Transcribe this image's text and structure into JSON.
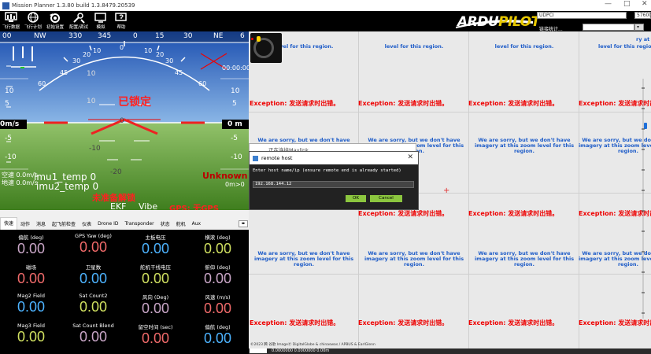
{
  "window": {
    "title": "Mission Planner 1.3.80 build 1.3.8479.20539",
    "controls": [
      "—",
      "□",
      "✕"
    ]
  },
  "toolbar": {
    "buttons": [
      {
        "label": "飞行数据",
        "icon": "flight-data-icon"
      },
      {
        "label": "飞行计划",
        "icon": "flight-plan-icon"
      },
      {
        "label": "初始设置",
        "icon": "initial-setup-icon"
      },
      {
        "label": "配置/调试",
        "icon": "config-tuning-icon"
      },
      {
        "label": "模拟",
        "icon": "simulation-icon"
      },
      {
        "label": "帮助",
        "icon": "help-icon"
      }
    ],
    "logo_a": "ARDU",
    "logo_b": "PILOT",
    "port": "UDPCI",
    "baud": "57600",
    "link_stats": "链接统计..."
  },
  "hud": {
    "heading_labels": [
      "00",
      "NW",
      "330",
      "345",
      "0",
      "15",
      "30",
      "NE",
      "6"
    ],
    "pitch_left": [
      "10",
      "5",
      "0m/s",
      "-5",
      "-10"
    ],
    "pitch_right": [
      "10",
      "5",
      "0 m",
      "-5",
      "-10"
    ],
    "pitch_center": [
      "10",
      "0",
      "-10",
      "-20"
    ],
    "roll_labels": [
      "10",
      "20",
      "30",
      "45",
      "60"
    ],
    "lock_status": "已锁定",
    "time": "00:00:00",
    "airspeed_line": "空速 0.0m/s",
    "groundspeed_line": "地速 0.0m/s",
    "imu1": "imu1_temp 0",
    "imu2": "imu2_temp 0",
    "mode": "Unknown",
    "dist": "0m>0",
    "not_ready": "未准备解锁",
    "ekf": "EKF",
    "vibe": "Vibe",
    "gps": "GPS: 无GPS"
  },
  "tabs": {
    "items": [
      "快速",
      "动作",
      "消息",
      "起飞前检查",
      "仪表",
      "Drone ID",
      "Transponder",
      "状态",
      "舵机",
      "Aux"
    ],
    "active": 0
  },
  "quick": {
    "cells": [
      {
        "label": "偏航 (deg)",
        "value": "0.00",
        "color": "#c9a6c7"
      },
      {
        "label": "GPS Yaw (deg)",
        "value": "0.00",
        "color": "#f06a6a"
      },
      {
        "label": "主板电压",
        "value": "0.00",
        "color": "#4db3ff"
      },
      {
        "label": "横滚 (deg)",
        "value": "0.00",
        "color": "#d0e060"
      },
      {
        "label": "磁场",
        "value": "0.00",
        "color": "#f06a6a"
      },
      {
        "label": "卫星数",
        "value": "0.00",
        "color": "#4db3ff"
      },
      {
        "label": "舵机干线电压",
        "value": "0.00",
        "color": "#d0e060"
      },
      {
        "label": "俯仰 (deg)",
        "value": "0.00",
        "color": "#c9a6c7"
      },
      {
        "label": "Mag2 Field",
        "value": "0.00",
        "color": "#4db3ff"
      },
      {
        "label": "Sat Count2",
        "value": "0.00",
        "color": "#d0e060"
      },
      {
        "label": "风向 (Deg)",
        "value": "0.00",
        "color": "#c9a6c7"
      },
      {
        "label": "风速 (m/s)",
        "value": "0.00",
        "color": "#f06a6a"
      },
      {
        "label": "Mag3 Field",
        "value": "0.00",
        "color": "#d0e060"
      },
      {
        "label": "Sat Count Blend",
        "value": "0.00",
        "color": "#c9a6c7"
      },
      {
        "label": "留空时间 (sec)",
        "value": "0.00",
        "color": "#f06a6a"
      },
      {
        "label": "偏航 (deg)",
        "value": "0.00",
        "color": "#4db3ff"
      }
    ]
  },
  "map": {
    "sorry_partial": "level for this region.",
    "sorry_full": "We are sorry, but we don't have imagery at this zoom level for this region.",
    "sorry_cut": "We are sorry, but we don't have imagery at this zoom level for this region.",
    "exception": "Exception: 发送请求时出错。",
    "copyright": "©2023 腾 谷歌 ImageⓅ DigitalGlobe & chinaswas / APBUS & EarlGlenn",
    "coords": "0.0000000  0.0000000   0.00m"
  },
  "dialog": {
    "behind_title": "正在连接Mavlink",
    "title": "remote host",
    "prompt": "Enter host name/ip (ensure remote end is already started)",
    "value": "192.168.144.12",
    "ok": "OK",
    "cancel": "Cancel"
  }
}
